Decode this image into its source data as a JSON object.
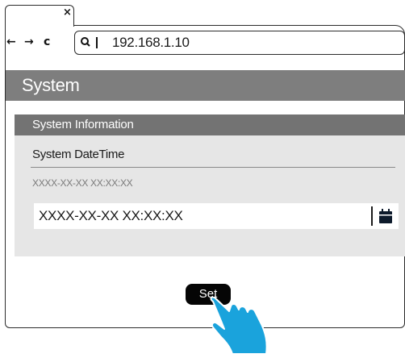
{
  "browser": {
    "tab_close": "×",
    "nav_back": "←",
    "nav_forward": "→",
    "nav_reload": "c",
    "url": "192.168.1.10"
  },
  "page": {
    "section_title": "System",
    "panel_title": "System Information",
    "datetime_label": "System DateTime",
    "datetime_hint": "XXXX-XX-XX XX:XX:XX",
    "datetime_value": "XXXX-XX-XX XX:XX:XX",
    "set_label": "Set"
  },
  "colors": {
    "sysbar": "#7e7e7e",
    "panel_header": "#737373",
    "panel_bg": "#e6e6e6",
    "hand": "#1aa3dc",
    "button": "#050505"
  },
  "icons": [
    "close-icon",
    "back-arrow-icon",
    "forward-arrow-icon",
    "reload-icon",
    "search-icon",
    "calendar-icon",
    "pointing-hand-icon"
  ]
}
